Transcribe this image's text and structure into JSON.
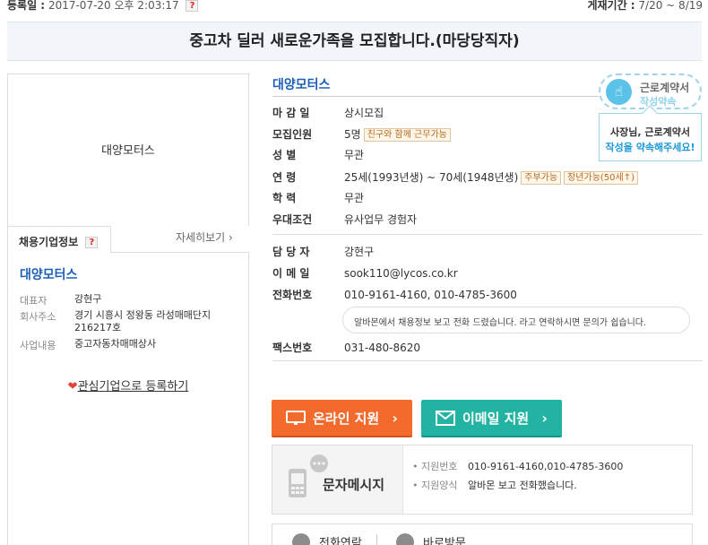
{
  "meta": {
    "registered_label": "등록일 :",
    "registered_value": "2017-07-20 오후 2:03:17",
    "help_glyph": "?",
    "period_label": "게재기간 :",
    "period_value": "7/20 ~ 8/19"
  },
  "title": "중고차 딜러 새로운가족을 모집합니다.(마당당직자)",
  "company_logo_text": "대양모터스",
  "company_info": {
    "tab_label": "채용기업정보",
    "tab_help": "?",
    "detail_link": "자세히보기 ›",
    "name": "대양모터스",
    "rows": [
      {
        "label": "대표자",
        "value": "강현구"
      },
      {
        "label": "회사주소",
        "value": "경기 시흥시 정왕동 라성매매단지 216217호"
      },
      {
        "label": "사업내용",
        "value": "중고자동차매매상사"
      }
    ],
    "interest_heart": "❤",
    "interest_link": "관심기업으로 등록하기"
  },
  "main": {
    "company_name": "대양모터스",
    "rows": [
      {
        "label": "마 감 일",
        "value": "상시모집"
      },
      {
        "label": "모집인원",
        "value": "5명",
        "tags": [
          "친구와 함께 근무가능"
        ]
      },
      {
        "label": "성    별",
        "value": "무관"
      },
      {
        "label": "연    령",
        "value": "25세(1993년생) ~ 70세(1948년생)",
        "tags": [
          "주부가능",
          "장년가능(50세↑)"
        ]
      },
      {
        "label": "학    력",
        "value": "무관"
      },
      {
        "label": "우대조건",
        "value": "유사업무 경험자"
      }
    ],
    "contact_rows": [
      {
        "label": "담 당 자",
        "value": "강현구"
      },
      {
        "label": "이 메 일",
        "value": "sook110@lycos.co.kr"
      },
      {
        "label": "전화번호",
        "value": "010-9161-4160, 010-4785-3600"
      }
    ],
    "notice": "알바몬에서 채용정보 보고 전화 드렸습니다. 라고 연락하시면 문의가 쉽습니다.",
    "fax": {
      "label": "팩스번호",
      "value": "031-480-8620"
    }
  },
  "contract_badge": {
    "line1": "근로계약서",
    "line2": "작성약속",
    "popup_line1": "사장님, 근로계약서",
    "popup_line2": "작성을 약속해주세요!"
  },
  "buttons": {
    "online_apply": "온라인 지원",
    "email_apply": "이메일 지원",
    "chevron": "›"
  },
  "sms": {
    "title": "문자메시지",
    "rows": [
      {
        "label": "• 지원번호",
        "value": "010-9161-4160,010-4785-3600"
      },
      {
        "label": "• 지원양식",
        "value": "알바몬 보고 전화했습니다."
      }
    ]
  },
  "bottom": {
    "phone_contact": "전화연락",
    "visit": "바로방문"
  },
  "colors": {
    "accent_blue": "#1d5fb8",
    "online_button": "#f26b2d",
    "email_button": "#23b3a3"
  }
}
